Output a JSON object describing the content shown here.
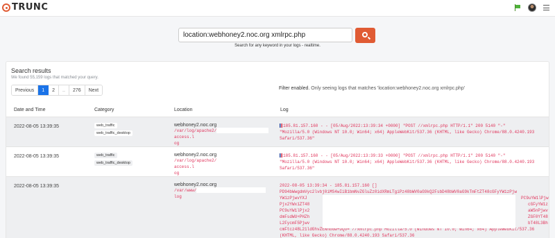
{
  "brand": {
    "name": "TRUNC"
  },
  "search": {
    "query": "location:webhoney2.noc.org xmlrpc.php",
    "hint": "Search for any keyword in your logs - realtime."
  },
  "results": {
    "title": "Search results",
    "subtitle": "We found 55,159 logs that matched your query.",
    "filter_label": "Filter enabled.",
    "filter_text": " Only seeing logs that matches 'location:webhoney2.noc.org xmlrpc.php'",
    "pagination": {
      "previous": "Previous",
      "pages": [
        "1",
        "2",
        "..",
        "276"
      ],
      "next": "Next",
      "active": "1"
    },
    "columns": [
      "Date and Time",
      "Category",
      "Location",
      "Log"
    ],
    "rows": [
      {
        "date": "2022-08-05 13:39:35",
        "tags": [
          "web_traffic",
          "web_traffic_desktop"
        ],
        "host": "webhoney2.noc.org",
        "path_a": "/var/log/apache2/",
        "path_b": "access.l",
        "path_c": "og",
        "log": [
          "185.81.157.160 - - [05/Aug/2022:13:39:34 +0000] \"POST //xmlrpc.php HTTP/1.1\" 200 5140 \"-\"",
          "\"Mozilla/5.0 (Windows NT 10.0; Win64; x64) AppleWebKit/537.36 (KHTML, like Gecko) Chrome/88.0.4240.193",
          "Safari/537.36\""
        ]
      },
      {
        "date": "2022-08-05 13:39:35",
        "tags": [
          "web_traffic",
          "web_traffic_desktop"
        ],
        "host": "webhoney2.noc.org",
        "path_a": "/var/log/apache2/",
        "path_b": "access.l",
        "path_c": "og",
        "log": [
          "185.81.157.160 - - [05/Aug/2022:13:39:33 +0000] \"POST //xmlrpc.php HTTP/1.1\" 200 5140 \"-\"",
          "\"Mozilla/5.0 (Windows NT 10.0; Win64; x64) AppleWebKit/537.36 (KHTML, like Gecko) Chrome/88.0.4240.193",
          "Safari/537.36\""
        ]
      },
      {
        "date": "2022-08-05 13:39:35",
        "host": "webhoney2.noc.org",
        "path_a": "/var/www/",
        "path_b": "log",
        "log": [
          "2022-08-05 13:39:34 - 185.81.157.160 []",
          "PD94bWwgdmVyc2lvbj0iMS4wIiB1bmNvZGluZz0idXRmLTgiPz48bWV0aG9kQ2FsbD48bWV0aG9kTmFtZT48cGFyYW1zPjw",
          "YW1zPjwvYXJ",
          "Pjx2YWx1ZT48",
          "PC9uYW1lPjx2",
          "dmFsdWU+PHZh",
          "L2FycmF5Pjwv",
          "cmFtcz48L21ldGhvZENhbGw+DQo= //xmlrpc.php Mozilla/5.0 (Windows NT 10.0; Win64; x64) AppleWebKit/537.36",
          "(KHTML, like Gecko) Chrome/88.0.4240.193 Safari/537.36"
        ],
        "log_right": [
          "PC9uYW1lPjw",
          "cGFyYW1z",
          "aW5nPjwv",
          "ZGF0YT48",
          "bT48L3Bh"
        ]
      }
    ]
  },
  "colors": {
    "accent": "#e05b34",
    "active_page": "#1a73e8",
    "log_text": "#e0345b"
  },
  "icons": [
    "search-icon",
    "flag-icon",
    "avatar",
    "menu-icon",
    "logo-mark"
  ]
}
